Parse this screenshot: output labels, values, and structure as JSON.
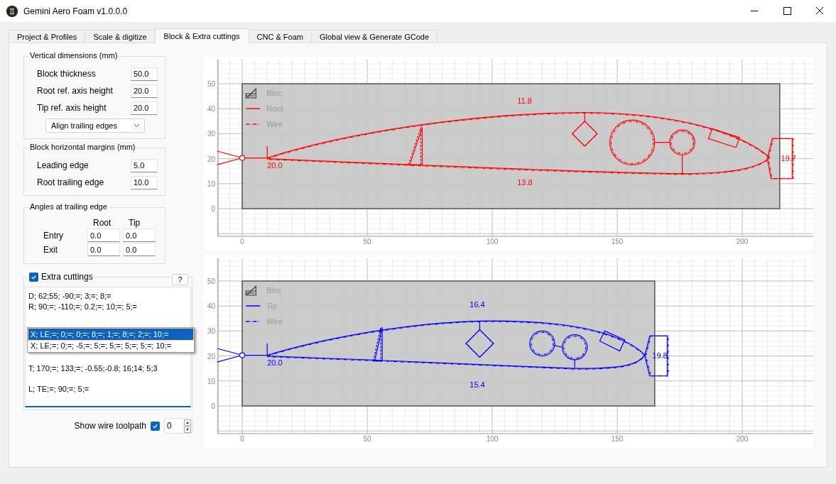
{
  "window": {
    "title": "Gemini Aero Foam v1.0.0.0"
  },
  "tabs": [
    {
      "label": "Project & Profiles",
      "selected": false
    },
    {
      "label": "Scale & digitize",
      "selected": false
    },
    {
      "label": "Block & Extra cuttings",
      "selected": true
    },
    {
      "label": "CNC & Foam",
      "selected": false
    },
    {
      "label": "Global view & Generate GCode",
      "selected": false
    }
  ],
  "vertical_dimensions": {
    "title": "Vertical dimensions (mm)",
    "fields": [
      {
        "label": "Block thickness",
        "value": "50.0"
      },
      {
        "label": "Root ref. axis height",
        "value": "20.0"
      },
      {
        "label": "Tip ref. axis height",
        "value": "20.0"
      }
    ],
    "dropdown": {
      "value": "Align trailing edges"
    }
  },
  "horizontal_margins": {
    "title": "Block horizontal margins (mm)",
    "fields": [
      {
        "label": "Leading edge",
        "value": "5.0"
      },
      {
        "label": "Root trailing edge",
        "value": "10.0"
      }
    ]
  },
  "angles": {
    "title": "Angles at trailing edge",
    "columns": [
      "Root",
      "Tip"
    ],
    "rows": [
      {
        "label": "Entry",
        "values": [
          "0.0",
          "0.0"
        ]
      },
      {
        "label": "Exit",
        "values": [
          "0.0",
          "0.0"
        ]
      }
    ]
  },
  "extra_cuttings": {
    "label": "Extra cuttings",
    "checked": true,
    "help": "?",
    "value": "D; 62;55; -90;=; 3;=; 8;=\nR; 90;=; -110;=; 0.2;=; 10;=; 5;=\n\n\n\n\n\nT; 170;=; 133;=; -0.55;-0.8; 16;14; 5;3\n\nL; TE;=; 90;=; 5;=",
    "suggestions": [
      {
        "text": "X; LE;=; 0;=; 0;=; 8;=; 1;=; 8;=; 2;=; 10;=",
        "selected": true
      },
      {
        "text": "X; LE;=; 0;=; -5;=; 5;=; 5;=; 5;=; 5;=; 10;=",
        "selected": false
      }
    ]
  },
  "show_wire_toolpath": {
    "label": "Show wire toolpath",
    "checked": true,
    "value": "0"
  },
  "plots": [
    {
      "kind": "root",
      "color": "#ff0000",
      "legend": [
        {
          "label": "Bloc",
          "kind": "block"
        },
        {
          "label": "Root",
          "kind": "solid"
        },
        {
          "label": "Wire",
          "kind": "dashdot"
        }
      ],
      "yticks": [
        "50",
        "40",
        "30",
        "20",
        "10",
        "0"
      ],
      "xticks": [
        "0",
        "50",
        "100",
        "150",
        "200"
      ],
      "dimensions": {
        "upper": "11.8",
        "lower": "13.8",
        "leading": "20.0",
        "trailing": "19.7"
      }
    },
    {
      "kind": "tip",
      "color": "#0000ff",
      "legend": [
        {
          "label": "Bloc",
          "kind": "block"
        },
        {
          "label": "Tip",
          "kind": "solid"
        },
        {
          "label": "Wire",
          "kind": "dashdot"
        }
      ],
      "yticks": [
        "50",
        "40",
        "30",
        "20",
        "10",
        "0"
      ],
      "xticks": [
        "0",
        "50",
        "100",
        "150",
        "200"
      ],
      "dimensions": {
        "upper": "16.4",
        "lower": "15.4",
        "leading": "20.0",
        "trailing": "19.8"
      }
    }
  ]
}
